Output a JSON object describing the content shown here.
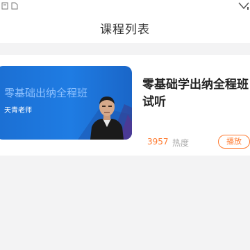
{
  "header": {
    "title": "课程列表"
  },
  "status_bar": {
    "icons": [
      "signal-icon",
      "sim-icon",
      "battery-icon"
    ]
  },
  "course": {
    "thumbnail_title": "零基础出纳全程班",
    "thumbnail_teacher": "天青老师",
    "name_line1": "零基础学出纳全程班",
    "name_line2": "试听",
    "heat_value": "3957",
    "heat_label": "热度",
    "play_label": "播放"
  },
  "colors": {
    "accent": "#ff7a2f",
    "thumbnail_blue": "#1f7ce3",
    "background": "#f3f3f4"
  }
}
